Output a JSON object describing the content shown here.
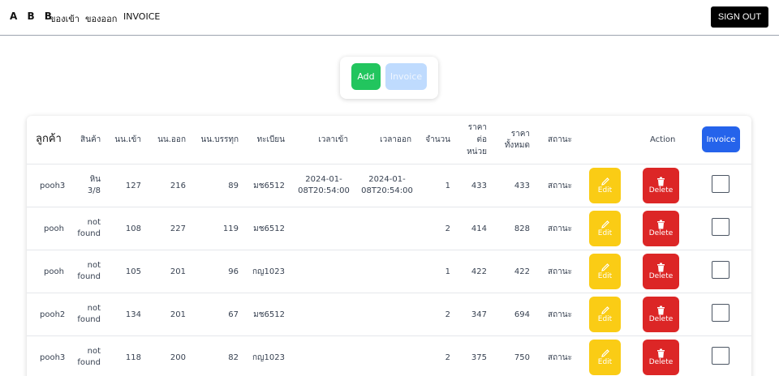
{
  "nav": {
    "brand": "A B B",
    "links": [
      "ของเข้า",
      "ของออก",
      "INVOICE"
    ],
    "signout_label": "SIGN OUT"
  },
  "actions": {
    "add_label": "Add",
    "invoice_label": "Invoice"
  },
  "table": {
    "headers": {
      "customer": "ลูกค้า",
      "product": "สินค้า",
      "weight_in": "นน.เข้า",
      "weight_out": "นน.ออก",
      "weight_load": "นน.บรรทุก",
      "plate": "ทะเบียน",
      "time_in": "เวลาเข้า",
      "time_out": "เวลาออก",
      "qty": "จำนวน",
      "unit_price_1": "ราคา",
      "unit_price_2": "ต่อ",
      "unit_price_3": "หน่วย",
      "total_1": "ราคา",
      "total_2": "ทั้งหมด",
      "status": "สถานะ",
      "action": "Action",
      "invoice_btn": "Invoice"
    },
    "edit_label": "Edit",
    "delete_label": "Delete",
    "rows": [
      {
        "customer": "pooh3",
        "product_1": "หิน",
        "product_2": "3/8",
        "w_in": "127",
        "w_out": "216",
        "w_load": "89",
        "plate": "มช6512",
        "t_in_1": "2024-01-",
        "t_in_2": "08T20:54:00",
        "t_out_1": "2024-01-",
        "t_out_2": "08T20:54:00",
        "qty": "1",
        "unit": "433",
        "total": "433",
        "status": "สถานะ"
      },
      {
        "customer": "pooh",
        "product_1": "not",
        "product_2": "found",
        "w_in": "108",
        "w_out": "227",
        "w_load": "119",
        "plate": "มช6512",
        "t_in_1": "",
        "t_in_2": "",
        "t_out_1": "",
        "t_out_2": "",
        "qty": "2",
        "unit": "414",
        "total": "828",
        "status": "สถานะ"
      },
      {
        "customer": "pooh",
        "product_1": "not",
        "product_2": "found",
        "w_in": "105",
        "w_out": "201",
        "w_load": "96",
        "plate": "กญ1023",
        "t_in_1": "",
        "t_in_2": "",
        "t_out_1": "",
        "t_out_2": "",
        "qty": "1",
        "unit": "422",
        "total": "422",
        "status": "สถานะ"
      },
      {
        "customer": "pooh2",
        "product_1": "not",
        "product_2": "found",
        "w_in": "134",
        "w_out": "201",
        "w_load": "67",
        "plate": "มช6512",
        "t_in_1": "",
        "t_in_2": "",
        "t_out_1": "",
        "t_out_2": "",
        "qty": "2",
        "unit": "347",
        "total": "694",
        "status": "สถานะ"
      },
      {
        "customer": "pooh3",
        "product_1": "not",
        "product_2": "found",
        "w_in": "118",
        "w_out": "200",
        "w_load": "82",
        "plate": "กญ1023",
        "t_in_1": "",
        "t_in_2": "",
        "t_out_1": "",
        "t_out_2": "",
        "qty": "2",
        "unit": "375",
        "total": "750",
        "status": "สถานะ"
      }
    ]
  }
}
